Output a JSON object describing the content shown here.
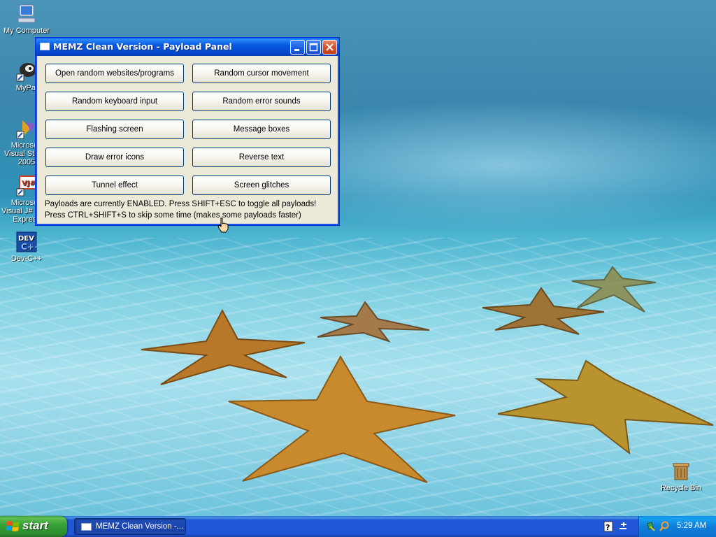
{
  "desktop": {
    "icons": [
      {
        "label": "My Computer"
      },
      {
        "label": "MyPal"
      },
      {
        "label": "Microsoft Visual Studio 2005"
      },
      {
        "label": "Microsoft Visual J# 2005 Express"
      },
      {
        "label": "Dev-C++"
      },
      {
        "label": "Recycle Bin"
      }
    ]
  },
  "window": {
    "title": "MEMZ Clean Version - Payload Panel",
    "buttons": [
      {
        "label": "Open random websites/programs"
      },
      {
        "label": "Random cursor movement"
      },
      {
        "label": "Random keyboard input"
      },
      {
        "label": "Random error sounds"
      },
      {
        "label": "Flashing screen"
      },
      {
        "label": "Message boxes"
      },
      {
        "label": "Draw error icons"
      },
      {
        "label": "Reverse text"
      },
      {
        "label": "Tunnel effect"
      },
      {
        "label": "Screen glitches"
      }
    ],
    "status_line_1": "Payloads are currently ENABLED. Press SHIFT+ESC to toggle all payloads!",
    "status_line_2": "Press CTRL+SHIFT+S to skip some time (makes some payloads faster)"
  },
  "taskbar": {
    "start_label": "start",
    "task_button_label": "MEMZ Clean Version -...",
    "clock": "5:29 AM"
  }
}
